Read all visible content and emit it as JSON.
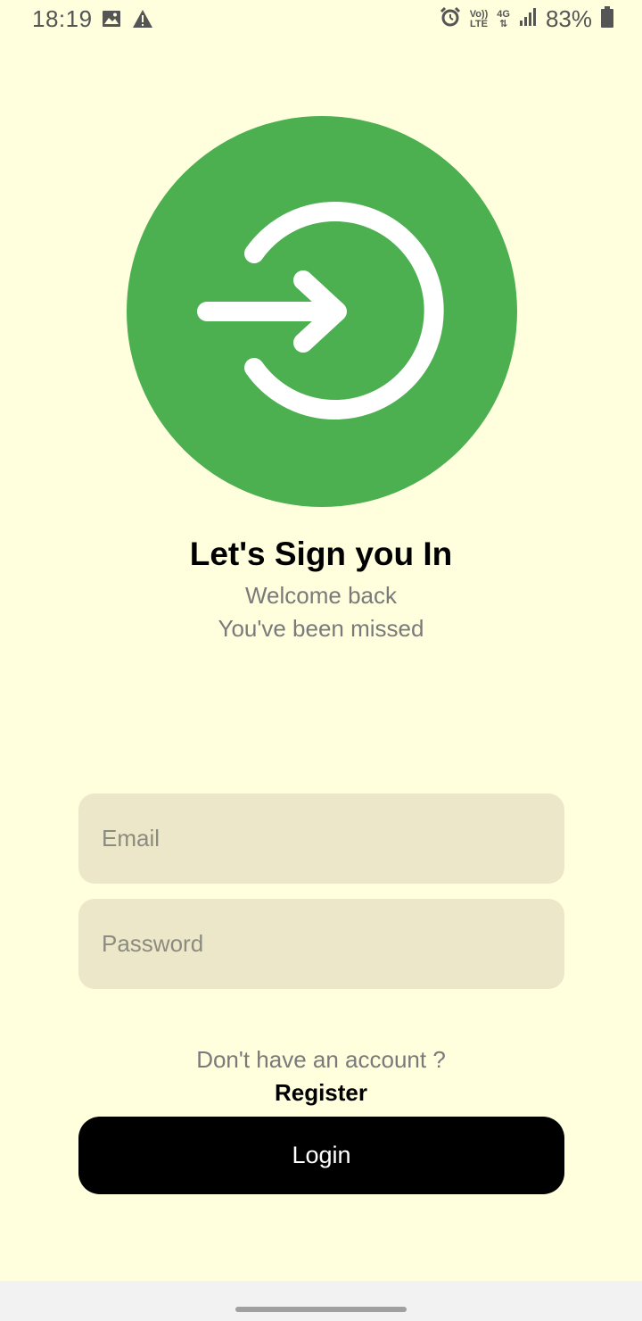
{
  "status_bar": {
    "time": "18:19",
    "volte_label_top": "Vo))",
    "volte_label_bottom": "LTE",
    "network_label": "4G",
    "battery_percent": "83%",
    "icons": [
      "image-icon",
      "warning-icon",
      "alarm-icon",
      "signal-icon",
      "battery-icon"
    ]
  },
  "hero": {
    "icon": "login-icon",
    "circle_color": "#4CAF50"
  },
  "header": {
    "title": "Let's Sign you In",
    "subtitle_line1": "Welcome back",
    "subtitle_line2": "You've been missed"
  },
  "form": {
    "email_placeholder": "Email",
    "email_value": "",
    "password_placeholder": "Password",
    "password_value": ""
  },
  "footer": {
    "no_account_text": "Don't have an account ?",
    "register_label": "Register",
    "login_label": "Login"
  },
  "colors": {
    "background": "#FFFFDE",
    "field_background": "#EDE7C9",
    "button_background": "#000000",
    "accent": "#4CAF50"
  }
}
